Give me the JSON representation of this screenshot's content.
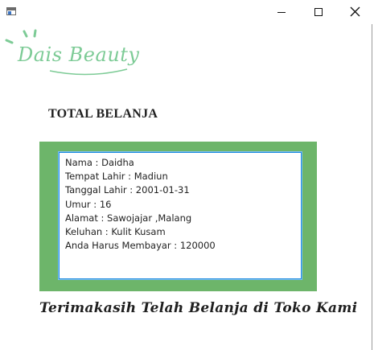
{
  "window": {
    "icon": "window-app-icon",
    "controls": [
      "minimize-icon",
      "maximize-icon",
      "close-icon"
    ]
  },
  "logo": {
    "text": "Dais Beauty",
    "color": "#7dcb96"
  },
  "heading": "TOTAL BELANJA",
  "receipt": {
    "lines": [
      "Nama : Daidha",
      "Tempat Lahir : Madiun",
      "Tanggal Lahir : 2001-01-31",
      "Umur : 16",
      "Alamat : Sawojajar ,Malang",
      "Keluhan : Kulit Kusam",
      "Anda Harus Membayar : 120000"
    ],
    "panel_color": "#6db56a",
    "border_color": "#1c8ae0"
  },
  "footer": "Terimakasih Telah Belanja di Toko Kami"
}
